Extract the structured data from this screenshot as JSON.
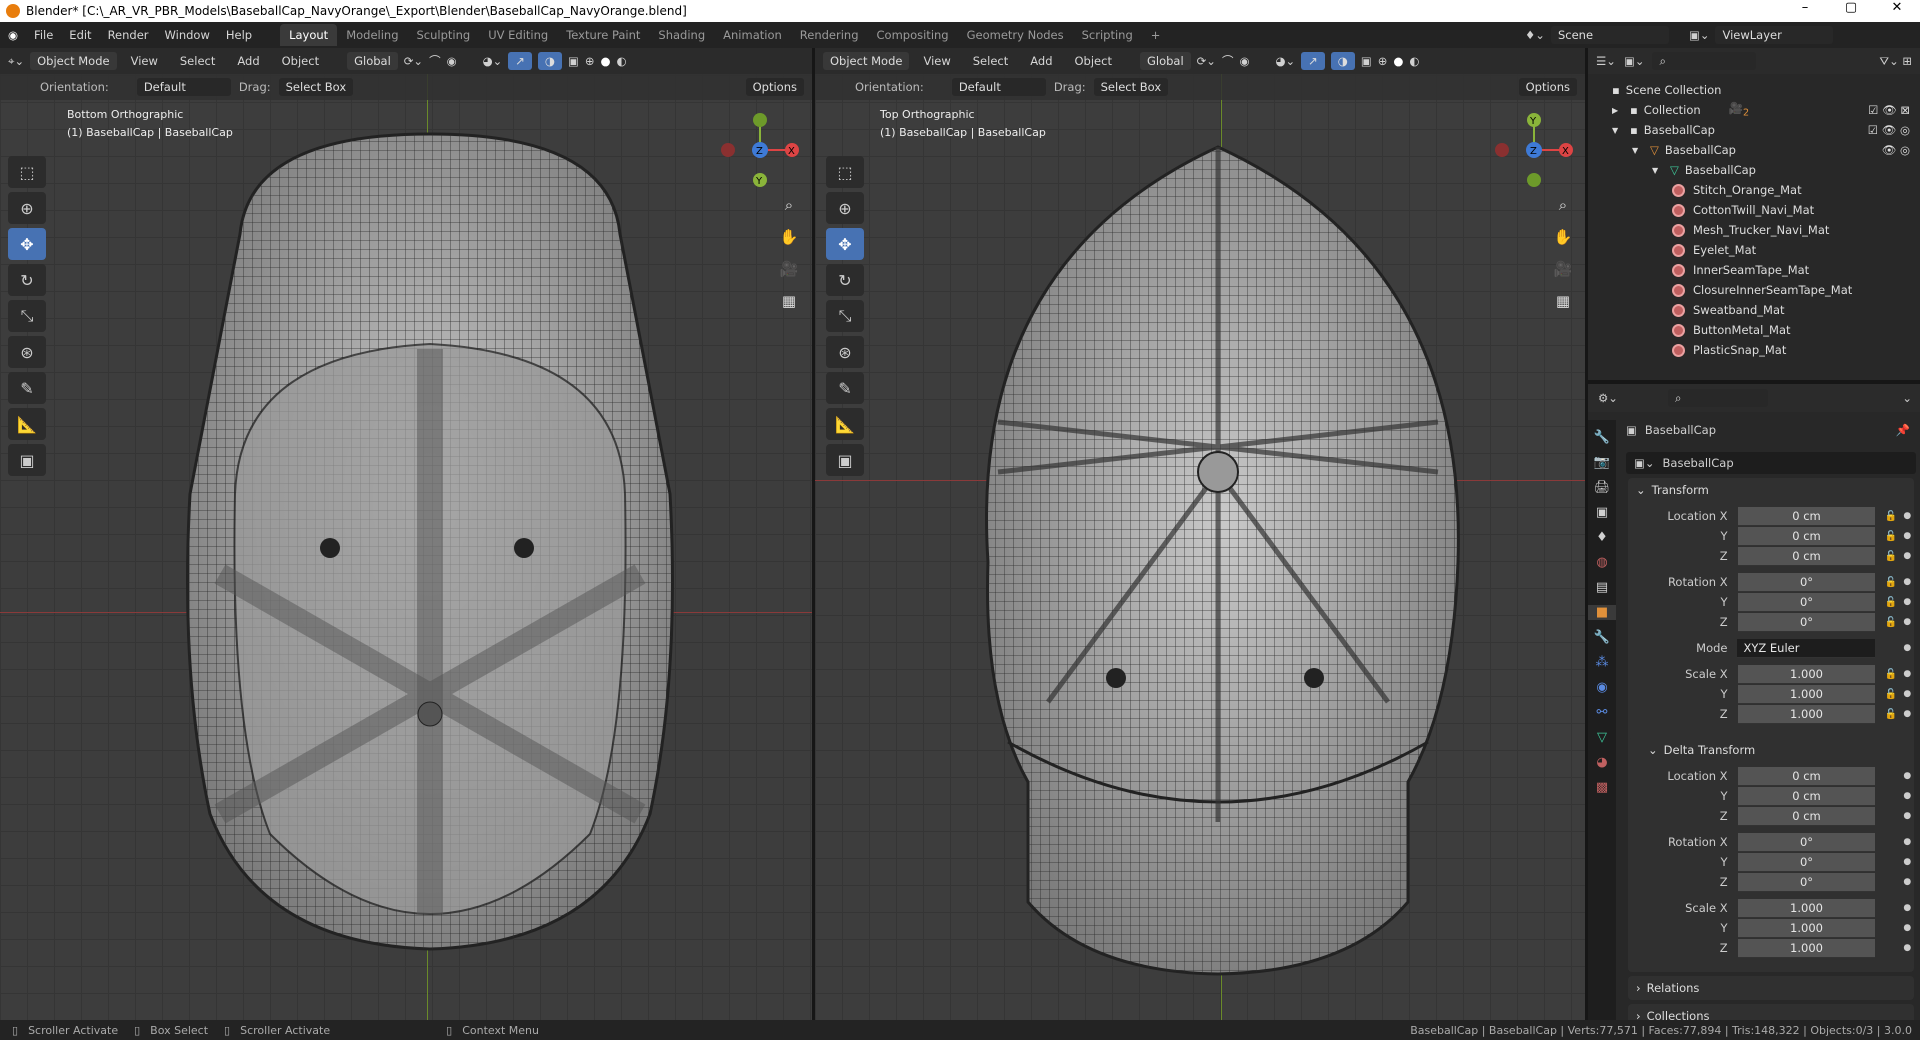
{
  "title": "Blender* [C:\\_AR_VR_PBR_Models\\BaseballCap_NavyOrange\\_Export\\Blender\\BaseballCap_NavyOrange.blend]",
  "window_controls": {
    "minimize": "–",
    "maximize": "▢",
    "close": "✕"
  },
  "menu": [
    "File",
    "Edit",
    "Render",
    "Window",
    "Help"
  ],
  "workspaces": [
    "Layout",
    "Modeling",
    "Sculpting",
    "UV Editing",
    "Texture Paint",
    "Shading",
    "Animation",
    "Rendering",
    "Compositing",
    "Geometry Nodes",
    "Scripting",
    "+"
  ],
  "scene": "Scene",
  "view_layer": "ViewLayer",
  "viewport_left": {
    "mode": "Object Mode",
    "menus": [
      "View",
      "Select",
      "Add",
      "Object"
    ],
    "transform": "Global",
    "orientation_label": "Orientation:",
    "orientation": "Default",
    "drag_label": "Drag:",
    "drag": "Select Box",
    "options": "Options",
    "view_name": "Bottom Orthographic",
    "object_info": "(1) BaseballCap | BaseballCap"
  },
  "viewport_right": {
    "mode": "Object Mode",
    "menus": [
      "View",
      "Select",
      "Add",
      "Object"
    ],
    "transform": "Global",
    "orientation_label": "Orientation:",
    "orientation": "Default",
    "drag_label": "Drag:",
    "drag": "Select Box",
    "options": "Options",
    "view_name": "Top Orthographic",
    "object_info": "(1) BaseballCap | BaseballCap"
  },
  "gizmo": {
    "x": "X",
    "y": "Y",
    "z": "Z"
  },
  "outliner": {
    "root": "Scene Collection",
    "collection": "Collection",
    "collection_badge": "2",
    "cap_collection": "BaseballCap",
    "object": "BaseballCap",
    "mesh": "BaseballCap",
    "materials": [
      "Stitch_Orange_Mat",
      "CottonTwill_Navi_Mat",
      "Mesh_Trucker_Navi_Mat",
      "Eyelet_Mat",
      "InnerSeamTape_Mat",
      "ClosureInnerSeamTape_Mat",
      "Sweatband_Mat",
      "ButtonMetal_Mat",
      "PlasticSnap_Mat"
    ]
  },
  "properties": {
    "object_name": "BaseballCap",
    "datablock": "BaseballCap",
    "transform": {
      "title": "Transform",
      "loc_label": "Location X",
      "rot_label": "Rotation X",
      "scale_label": "Scale X",
      "mode_label": "Mode",
      "y": "Y",
      "z": "Z",
      "location": [
        "0 cm",
        "0 cm",
        "0 cm"
      ],
      "rotation": [
        "0°",
        "0°",
        "0°"
      ],
      "mode": "XYZ Euler",
      "scale": [
        "1.000",
        "1.000",
        "1.000"
      ]
    },
    "delta": {
      "title": "Delta Transform",
      "location": [
        "0 cm",
        "0 cm",
        "0 cm"
      ],
      "rotation": [
        "0°",
        "0°",
        "0°"
      ],
      "scale": [
        "1.000",
        "1.000",
        "1.000"
      ]
    },
    "relations": "Relations",
    "collections": "Collections"
  },
  "status": {
    "left": [
      "Scroller Activate",
      "Box Select",
      "Scroller Activate",
      "Context Menu"
    ],
    "stats": "BaseballCap | BaseballCap | Verts:77,571 | Faces:77,894 | Tris:148,322 | Objects:0/3 | 3.0.0"
  }
}
